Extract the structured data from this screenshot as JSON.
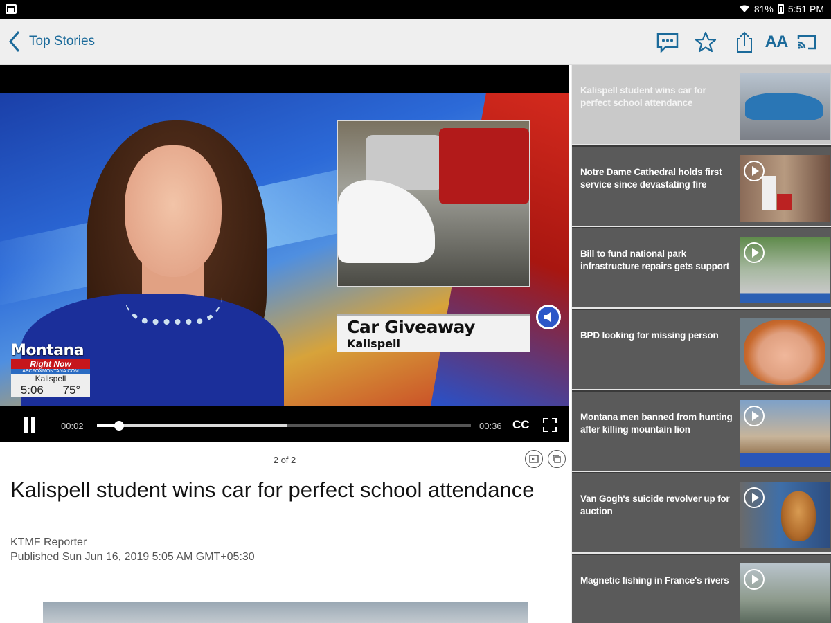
{
  "status_bar": {
    "battery": "81%",
    "time": "5:51 PM"
  },
  "toolbar": {
    "back_label": "Top Stories",
    "font_size_label": "AA",
    "icons": [
      "comments-icon",
      "star-icon",
      "share-icon",
      "font-size-icon",
      "cast-icon"
    ],
    "accent_color": "#1b6a9a"
  },
  "video": {
    "lower_third_title": "Car Giveaway",
    "lower_third_subtitle": "Kalispell",
    "station_name": "Montana",
    "station_tagline": "Right Now",
    "station_url": "ABCFOXMONTANA.COM",
    "station_city": "Kalispell",
    "station_time": "5:06",
    "station_temp": "75°",
    "elapsed": "00:02",
    "duration": "00:36",
    "played_fraction": 0.06,
    "buffered_fraction": 0.51,
    "cc_label": "CC"
  },
  "article": {
    "counter": "2 of 2",
    "headline": "Kalispell student wins car for perfect school attendance",
    "author": "KTMF Reporter",
    "published": "Published Sun Jun 16, 2019 5:05 AM GMT+05:30"
  },
  "sidebar": {
    "stories": [
      {
        "title": "Kalispell student wins car for perfect school attendance",
        "active": true,
        "video": false
      },
      {
        "title": "Notre Dame Cathedral holds first service since devastating fire",
        "active": false,
        "video": true
      },
      {
        "title": "Bill to fund national park infrastructure repairs gets support",
        "active": false,
        "video": true
      },
      {
        "title": "BPD looking for missing person",
        "active": false,
        "video": false
      },
      {
        "title": "Montana men banned from hunting after killing mountain lion",
        "active": false,
        "video": true
      },
      {
        "title": "Van Gogh's suicide revolver up for auction",
        "active": false,
        "video": true
      },
      {
        "title": "Magnetic fishing in France's rivers",
        "active": false,
        "video": true
      }
    ]
  }
}
